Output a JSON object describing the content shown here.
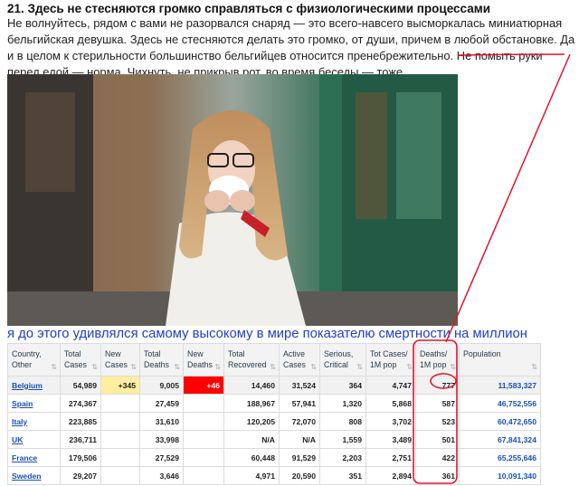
{
  "article": {
    "heading": "21. Здесь не стесняются громко справляться с физиологическими процессами",
    "paragraph": "Не волнуйтесь, рядом с вами не разорвался снаряд — это всего-навсего высморкалась миниатюрная бельгийская девушка. Здесь не стесняются делать это громко, от души, причем в любой обстановке. Да и в целом к стерильности большинство бельгийцев относится пренебрежительно. Не помыть руки перед едой — норма. Чихнуть, не прикрыв рот, во время беседы — тоже.",
    "photo_subject": "woman-blowing-nose-photo",
    "caption": "я до этого удивлялся самому высокому в мире показателю смертности на миллион"
  },
  "table": {
    "headers": [
      "Country, Other",
      "Total Cases",
      "New Cases",
      "Total Deaths",
      "New Deaths",
      "Total Recovered",
      "Active Cases",
      "Serious, Critical",
      "Tot Cases/ 1M pop",
      "Deaths/ 1M pop",
      "Population"
    ],
    "rows": [
      [
        "Belgium",
        "54,989",
        "+345",
        "9,005",
        "+46",
        "14,460",
        "31,524",
        "364",
        "4,747",
        "777",
        "11,583,327"
      ],
      [
        "Spain",
        "274,367",
        "",
        "27,459",
        "",
        "188,967",
        "57,941",
        "1,320",
        "5,868",
        "587",
        "46,752,556"
      ],
      [
        "Italy",
        "223,885",
        "",
        "31,610",
        "",
        "120,205",
        "72,070",
        "808",
        "3,702",
        "523",
        "60,472,650"
      ],
      [
        "UK",
        "236,711",
        "",
        "33,998",
        "",
        "N/A",
        "N/A",
        "1,559",
        "3,489",
        "501",
        "67,841,324"
      ],
      [
        "France",
        "179,506",
        "",
        "27,529",
        "",
        "60,448",
        "91,529",
        "2,203",
        "2,751",
        "422",
        "65,255,646"
      ],
      [
        "Sweden",
        "29,207",
        "",
        "3,646",
        "",
        "4,971",
        "20,590",
        "351",
        "2,894",
        "361",
        "10,091,340"
      ]
    ]
  },
  "colors": {
    "caption_text": "#1f3fbf",
    "link": "#1a4fb5",
    "new_cases_highlight": "#ffee9e",
    "new_deaths_highlight": "#ff0000",
    "annotation": "#e0162b"
  }
}
